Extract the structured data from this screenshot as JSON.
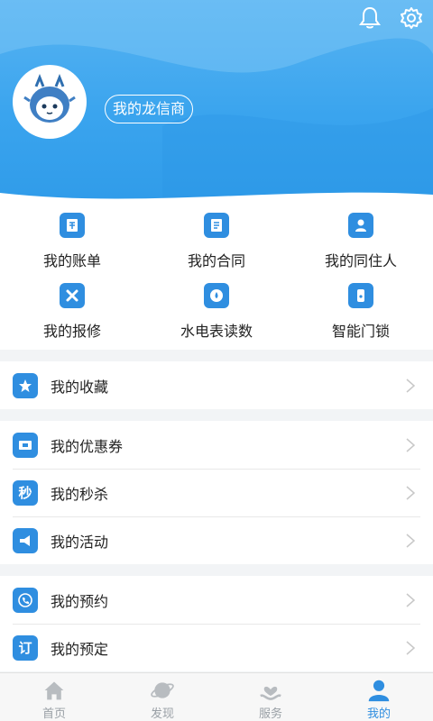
{
  "profile": {
    "title": "我的龙信商"
  },
  "grid": [
    {
      "label": "我的账单",
      "icon": "bill-icon"
    },
    {
      "label": "我的合同",
      "icon": "contract-icon"
    },
    {
      "label": "我的同住人",
      "icon": "roommate-icon"
    },
    {
      "label": "我的报修",
      "icon": "repair-icon"
    },
    {
      "label": "水电表读数",
      "icon": "meter-icon"
    },
    {
      "label": "智能门锁",
      "icon": "lock-icon"
    }
  ],
  "list": {
    "favorites": {
      "label": "我的收藏",
      "icon": "star-icon"
    },
    "coupons": {
      "label": "我的优惠券",
      "icon": "coupon-icon"
    },
    "flash": {
      "label": "我的秒杀",
      "icon_text": "秒"
    },
    "events": {
      "label": "我的活动",
      "icon": "megaphone-icon"
    },
    "appointment": {
      "label": "我的预约",
      "icon": "phone-icon"
    },
    "booking": {
      "label": "我的预定",
      "icon_text": "订"
    }
  },
  "tabs": [
    {
      "label": "首页",
      "icon": "home-icon"
    },
    {
      "label": "发现",
      "icon": "planet-icon"
    },
    {
      "label": "服务",
      "icon": "heart-hand-icon"
    },
    {
      "label": "我的",
      "icon": "user-icon",
      "active": true
    }
  ],
  "colors": {
    "header": "#3aa4ee",
    "accent": "#2f8ee0",
    "tab_inactive": "#9aa0a6"
  }
}
